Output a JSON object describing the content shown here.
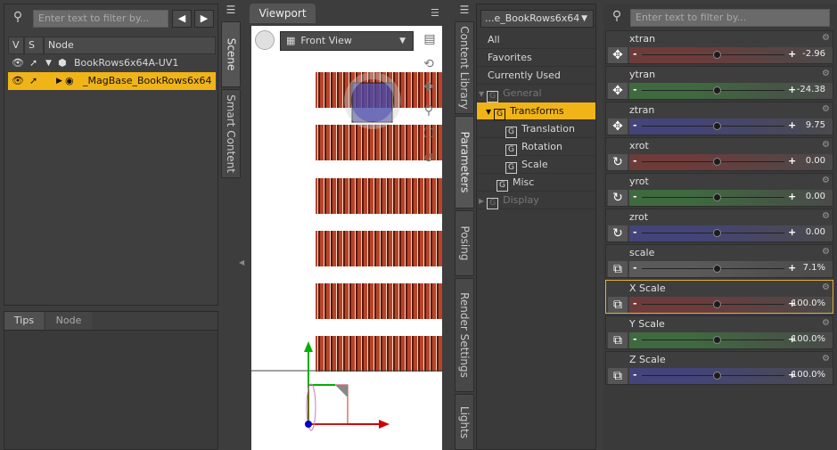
{
  "scene": {
    "filter_placeholder": "Enter text to filter by...",
    "col_v": "V",
    "col_s": "S",
    "col_node": "Node",
    "rows": [
      {
        "label": "BookRows6x64A-UV1"
      },
      {
        "label": "_MagBase_BookRows6x64"
      }
    ]
  },
  "tips": {
    "tab_tips": "Tips",
    "tab_node": "Node"
  },
  "left_vtabs": {
    "scene": "Scene",
    "smart_content": "Smart Content"
  },
  "viewport": {
    "tab_label": "Viewport",
    "view_select": "Front View"
  },
  "right_vtabs": {
    "content_library": "Content Library",
    "parameters": "Parameters",
    "posing": "Posing",
    "render_settings": "Render Settings",
    "lights": "Lights"
  },
  "ptree": {
    "node_select": "...e_BookRows6x64",
    "items": [
      "All",
      "Favorites",
      "Currently Used"
    ],
    "general": "General",
    "transforms": "Transforms",
    "translation": "Translation",
    "rotation": "Rotation",
    "scale": "Scale",
    "misc": "Misc",
    "display": "Display"
  },
  "params": {
    "filter_placeholder": "Enter text to filter by...",
    "list": [
      {
        "name": "xtran",
        "value": "-2.96",
        "icon": "move-icon",
        "tint": "#6e3b3b"
      },
      {
        "name": "ytran",
        "value": "-24.38",
        "icon": "move-icon",
        "tint": "#3f6a3f"
      },
      {
        "name": "ztran",
        "value": "9.75",
        "icon": "move-icon",
        "tint": "#44447a"
      },
      {
        "name": "xrot",
        "value": "0.00",
        "icon": "rotate-icon",
        "tint": "#6e3b3b"
      },
      {
        "name": "yrot",
        "value": "0.00",
        "icon": "rotate-icon",
        "tint": "#3f6a3f"
      },
      {
        "name": "zrot",
        "value": "0.00",
        "icon": "rotate-icon",
        "tint": "#44447a"
      },
      {
        "name": "scale",
        "value": "7.1%",
        "icon": "scale-icon",
        "tint": "#5a5a5a"
      },
      {
        "name": "X Scale",
        "value": "100.0%",
        "icon": "scale-icon",
        "tint": "#6e3b3b"
      },
      {
        "name": "Y Scale",
        "value": "100.0%",
        "icon": "scale-icon",
        "tint": "#3f6a3f"
      },
      {
        "name": "Z Scale",
        "value": "100.0%",
        "icon": "scale-icon",
        "tint": "#44447a"
      }
    ]
  },
  "colors": {
    "selection": "#f0b418",
    "x_axis": "#d00000",
    "y_axis": "#00b000",
    "z_axis": "#0000c0"
  }
}
